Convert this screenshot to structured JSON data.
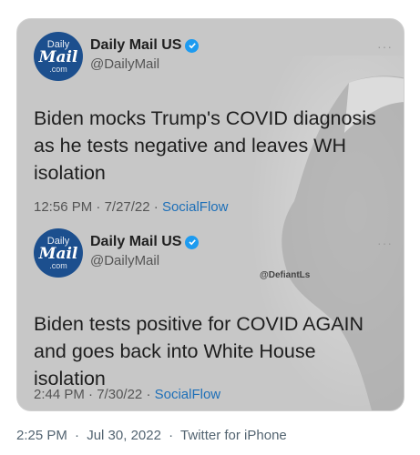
{
  "quoted_card": {
    "tweets": [
      {
        "logo": {
          "line1": "Daily",
          "line2": "Mail",
          "line3": ".com"
        },
        "display_name": "Daily Mail US",
        "handle": "@DailyMail",
        "text": "Biden mocks Trump's COVID diagnosis as he tests negative and leaves WH isolation",
        "time": "12:56 PM",
        "date": "7/27/22",
        "source": "SocialFlow"
      },
      {
        "logo": {
          "line1": "Daily",
          "line2": "Mail",
          "line3": ".com"
        },
        "display_name": "Daily Mail US",
        "handle": "@DailyMail",
        "text": "Biden tests positive for COVID AGAIN and goes back into White House isolation",
        "time": "2:44 PM",
        "date": "7/30/22",
        "source": "SocialFlow"
      }
    ],
    "watermark": "@DefiantLs",
    "more_icon": "more-horizontal-icon",
    "verified_icon": "verified-badge-icon"
  },
  "footer": {
    "time": "2:25 PM",
    "date": "Jul 30, 2022",
    "client": "Twitter for iPhone"
  },
  "colors": {
    "card_bg": "#c7c7c7",
    "logo_blue": "#1c4f8e",
    "verified_blue": "#1d9bf0",
    "link_blue": "#1d6fb8",
    "meta_gray": "#536471"
  }
}
